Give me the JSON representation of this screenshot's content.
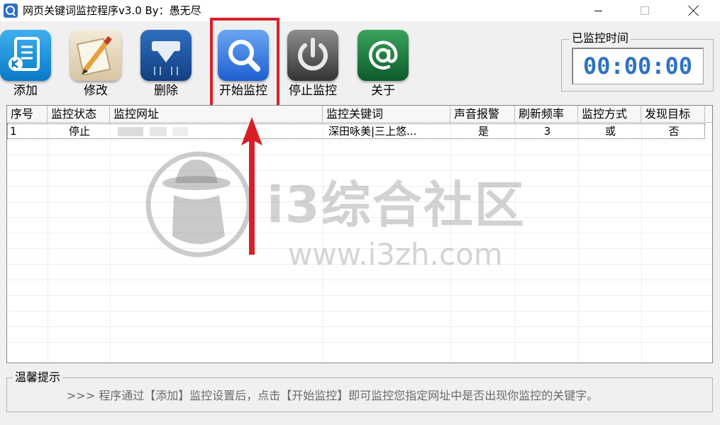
{
  "window": {
    "title": "网页关键词监控程序v3.0     By：愚无尽"
  },
  "toolbar": [
    {
      "label": "添加",
      "icon": "add-list-icon"
    },
    {
      "label": "修改",
      "icon": "edit-pencil-icon"
    },
    {
      "label": "删除",
      "icon": "delete-icon"
    },
    {
      "label": "开始监控",
      "icon": "magnifier-icon"
    },
    {
      "label": "停止监控",
      "icon": "power-icon"
    },
    {
      "label": "关于",
      "icon": "at-sign-icon"
    }
  ],
  "timer": {
    "legend": "已监控时间",
    "value": "00:00:00"
  },
  "table": {
    "columns": [
      "序号",
      "监控状态",
      "监控网址",
      "监控关键词",
      "声音报警",
      "刷新频率",
      "监控方式",
      "发现目标"
    ],
    "rows": [
      {
        "index": "1",
        "status": "停止",
        "url": "",
        "keywords": "深田咏美|三上悠...",
        "sound": "是",
        "refresh": "3",
        "mode": "或",
        "found": "否"
      }
    ]
  },
  "hint": {
    "legend": "温馨提示",
    "text": ">>> 程序通过【添加】监控设置后，点击【开始监控】即可监控您指定网址中是否出现你监控的关键字。"
  },
  "watermark": {
    "title": "i3综合社区",
    "url": "www.i3zh.com"
  },
  "colors": {
    "highlight": "#d91f26",
    "timer_text": "#2f73c2",
    "accent": "#2d6fc9"
  }
}
